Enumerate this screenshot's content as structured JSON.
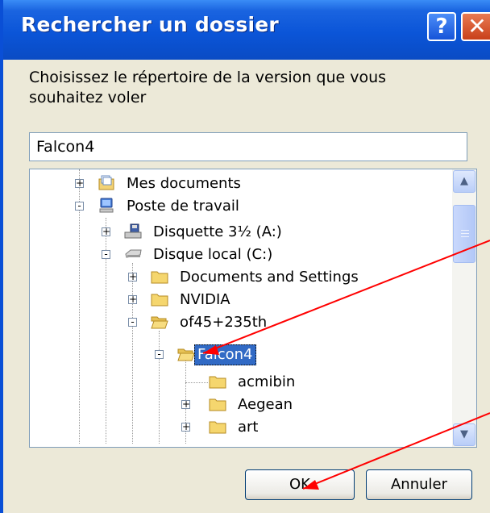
{
  "window": {
    "title": "Rechercher un dossier"
  },
  "dialog": {
    "prompt": "Choisissez le répertoire de la version que vous souhaitez voler",
    "path_value": "Falcon4"
  },
  "tree": {
    "items": [
      {
        "label": "Mes documents",
        "icon": "my-documents-icon",
        "expander": "+"
      },
      {
        "label": "Poste de travail",
        "icon": "my-computer-icon",
        "expander": "-"
      },
      {
        "label": "Disquette 3½ (A:)",
        "icon": "floppy-drive-icon",
        "expander": "+"
      },
      {
        "label": "Disque local (C:)",
        "icon": "hard-drive-icon",
        "expander": "-"
      },
      {
        "label": "Documents and Settings",
        "icon": "folder-icon",
        "expander": "+"
      },
      {
        "label": "NVIDIA",
        "icon": "folder-icon",
        "expander": "+"
      },
      {
        "label": "of45+235th",
        "icon": "folder-open-icon",
        "expander": "-"
      },
      {
        "label": "Falcon4",
        "icon": "folder-open-icon",
        "expander": "-",
        "selected": true
      },
      {
        "label": "acmibin",
        "icon": "folder-icon",
        "expander": ""
      },
      {
        "label": "Aegean",
        "icon": "folder-icon",
        "expander": "+"
      },
      {
        "label": "art",
        "icon": "folder-icon",
        "expander": "+"
      }
    ]
  },
  "buttons": {
    "ok": "OK",
    "cancel": "Annuler"
  },
  "colors": {
    "titlebar": "#0b55d8",
    "selection": "#316ac5",
    "annotation_arrow": "#ff0000"
  }
}
